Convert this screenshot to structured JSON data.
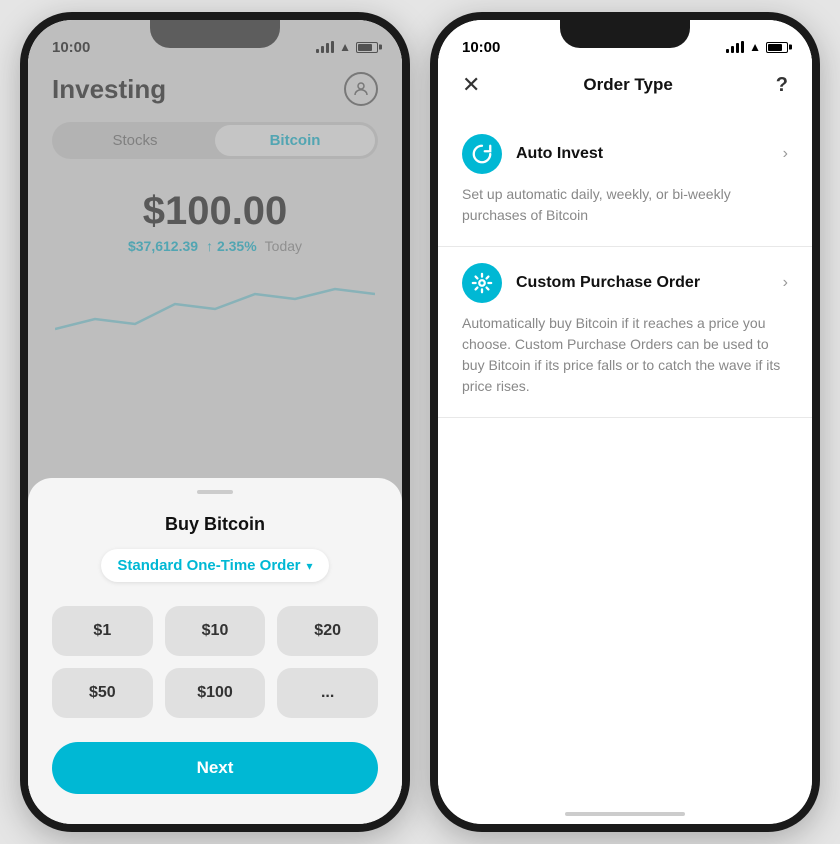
{
  "leftPhone": {
    "statusBar": {
      "time": "10:00"
    },
    "header": {
      "title": "Investing",
      "profileIcon": "👤"
    },
    "tabs": [
      {
        "label": "Stocks",
        "active": false
      },
      {
        "label": "Bitcoin",
        "active": true
      }
    ],
    "priceDisplay": {
      "mainPrice": "$100.00",
      "btcPrice": "$37,612.39",
      "change": "↑ 2.35%",
      "period": "Today"
    },
    "bottomSheet": {
      "title": "Buy Bitcoin",
      "orderType": "Standard One-Time Order",
      "amounts": [
        "$1",
        "$10",
        "$20",
        "$50",
        "$100",
        "..."
      ],
      "nextButton": "Next"
    }
  },
  "rightPhone": {
    "statusBar": {
      "time": "10:00"
    },
    "header": {
      "closeLabel": "✕",
      "title": "Order Type",
      "helpLabel": "?"
    },
    "orderOptions": [
      {
        "id": "auto-invest",
        "iconType": "rotate",
        "label": "Auto Invest",
        "description": "Set up automatic daily, weekly, or bi-weekly purchases of Bitcoin"
      },
      {
        "id": "custom-purchase",
        "iconType": "custom",
        "label": "Custom Purchase Order",
        "description": "Automatically buy Bitcoin if it reaches a price you choose. Custom Purchase Orders can be used to buy Bitcoin if its price falls or to catch the wave if its price rises."
      }
    ]
  }
}
